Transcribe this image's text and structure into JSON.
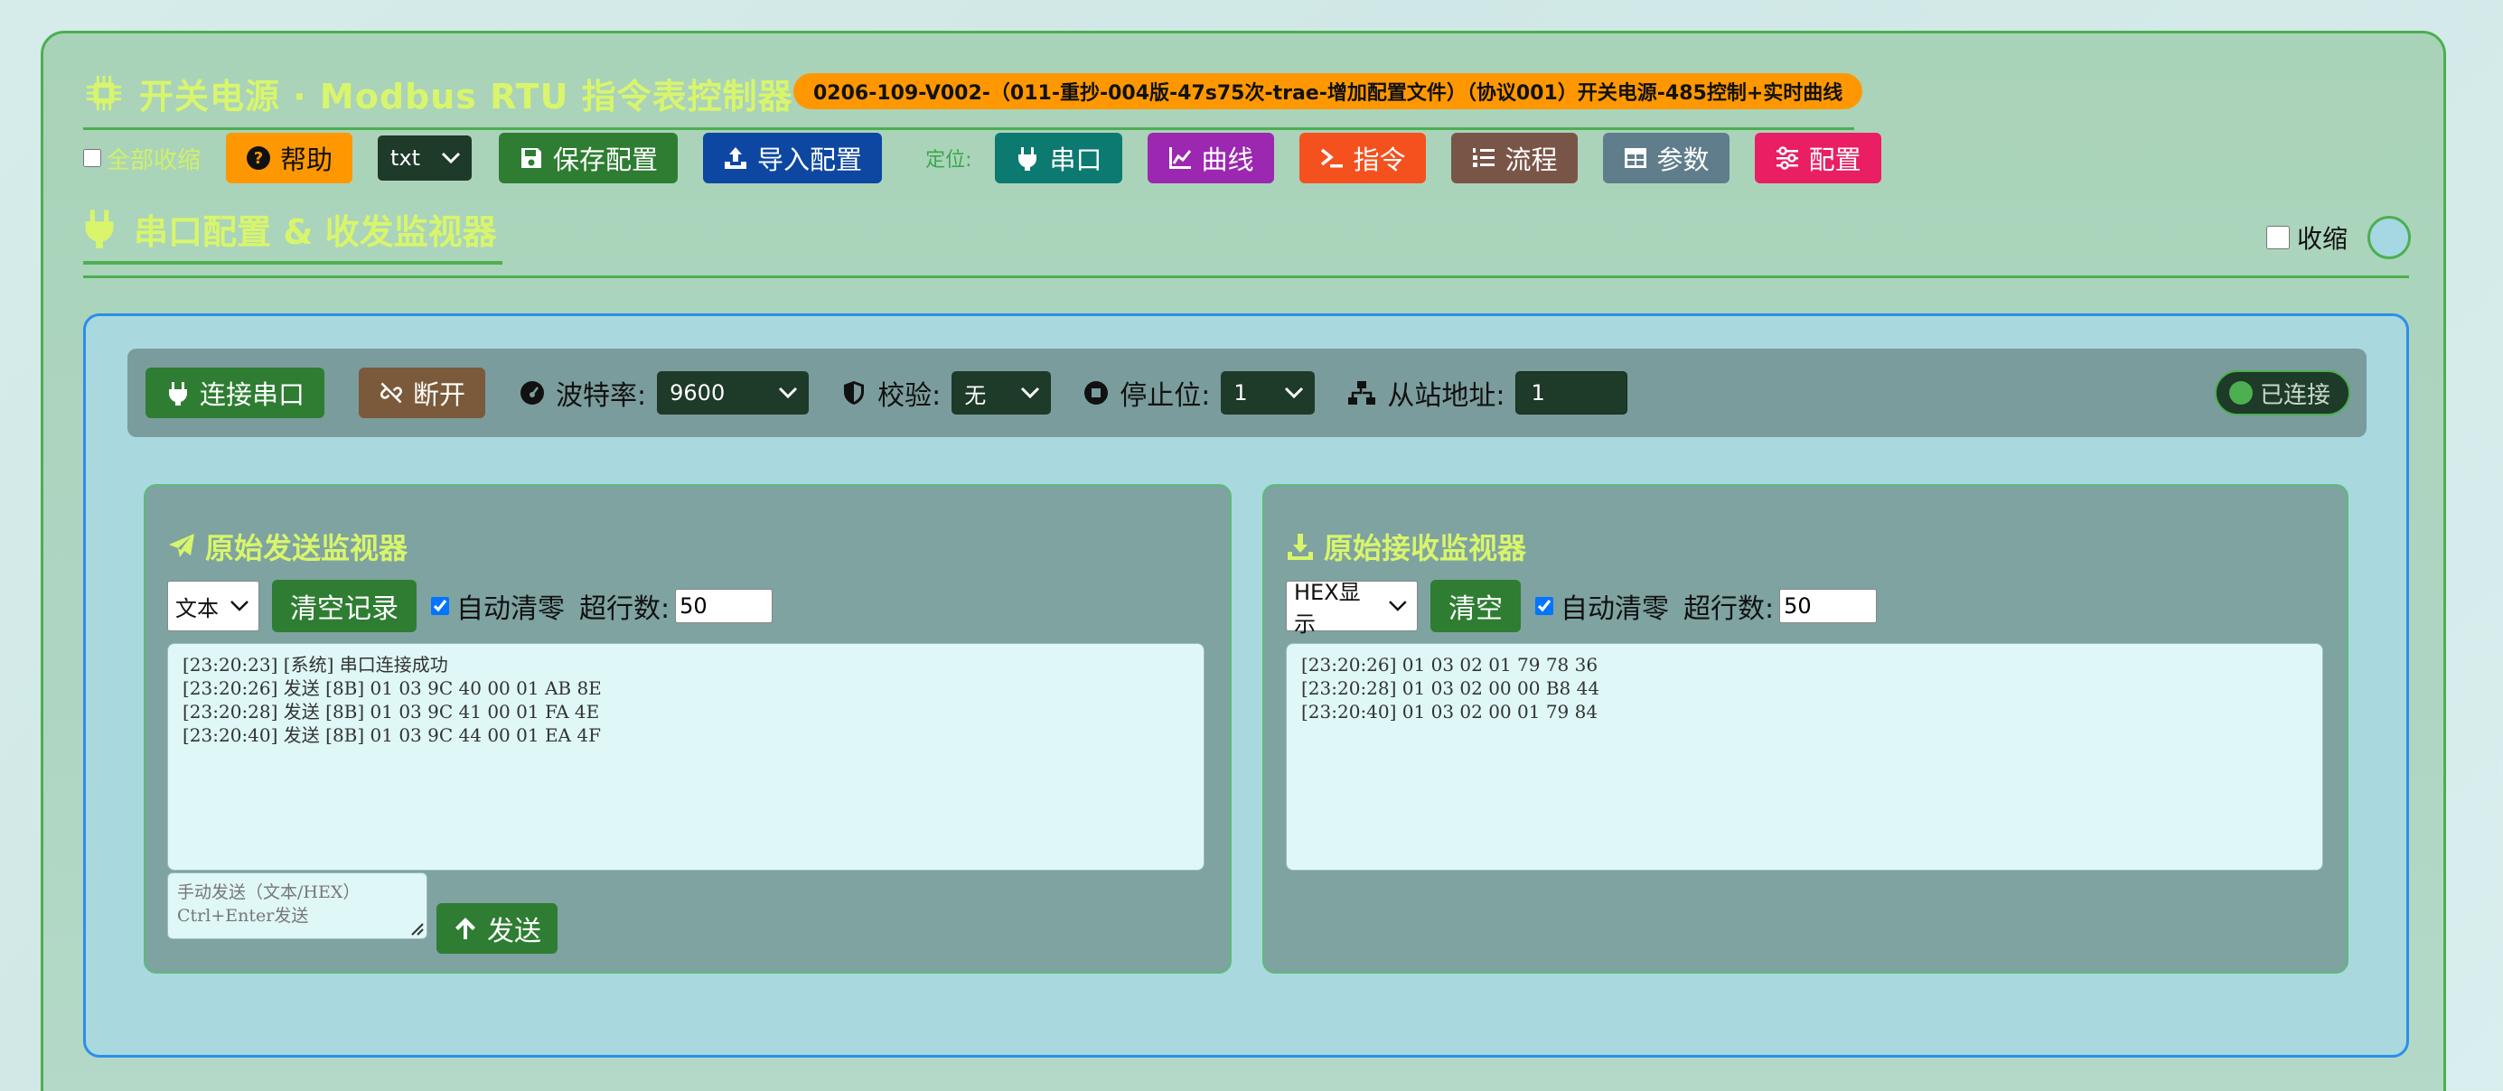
{
  "header": {
    "title": "开关电源 · Modbus RTU 指令表控制器",
    "version_badge": "0206-109-V002-（011-重抄-004版-47s75次-trae-增加配置文件）（协议001）开关电源-485控制+实时曲线",
    "title_icon": "chip-icon"
  },
  "toolbar": {
    "collapse_all_label": "全部收缩",
    "help_label": "帮助",
    "format_selected": "txt",
    "save_label": "保存配置",
    "import_label": "导入配置",
    "locate_label": "定位:",
    "nav": [
      {
        "label": "串口",
        "icon": "plug-icon",
        "color": "#0c7a70"
      },
      {
        "label": "曲线",
        "icon": "chart-line-icon",
        "color": "#9c27b0"
      },
      {
        "label": "指令",
        "icon": "terminal-icon",
        "color": "#f4511e"
      },
      {
        "label": "流程",
        "icon": "list-ol-icon",
        "color": "#795548"
      },
      {
        "label": "参数",
        "icon": "table-icon",
        "color": "#607d8b"
      },
      {
        "label": "配置",
        "icon": "sliders-icon",
        "color": "#e91e63"
      }
    ]
  },
  "section": {
    "title": "串口配置 & 收发监视器",
    "collapse_label": "收缩"
  },
  "connection": {
    "connect_label": "连接串口",
    "disconnect_label": "断开",
    "baud_label": "波特率:",
    "baud_value": "9600",
    "parity_label": "校验:",
    "parity_value": "无",
    "stopbits_label": "停止位:",
    "stopbits_value": "1",
    "slave_label": "从站地址:",
    "slave_value": "1",
    "status_label": "已连接"
  },
  "send_monitor": {
    "title": "原始发送监视器",
    "mode_selected": "文本",
    "clear_label": "清空记录",
    "auto_clear_label": "自动清零",
    "max_rows_label": "超行数:",
    "max_rows_value": "50",
    "log": [
      "[23:20:23] [系统] 串口连接成功",
      "[23:20:26] 发送 [8B] 01 03 9C 40 00 01 AB 8E",
      "[23:20:28] 发送 [8B] 01 03 9C 41 00 01 FA 4E",
      "[23:20:40] 发送 [8B] 01 03 9C 44 00 01 EA 4F"
    ],
    "manual_placeholder_line1": "手动发送（文本/HEX）",
    "manual_placeholder_line2": "Ctrl+Enter发送",
    "send_label": "发送"
  },
  "recv_monitor": {
    "title": "原始接收监视器",
    "mode_selected": "HEX显示",
    "clear_label": "清空",
    "auto_clear_label": "自动清零",
    "max_rows_label": "超行数:",
    "max_rows_value": "50",
    "log": [
      "[23:20:26] 01 03 02 01 79 78 36",
      "[23:20:28] 01 03 02 00 00 B8 44",
      "[23:20:40] 01 03 02 00 01 79 84"
    ]
  },
  "colors": {
    "accent_text": "#d8f56c",
    "green_button": "#2e7d32",
    "blue_button": "#0d47a1",
    "orange_badge": "#ff9800",
    "brown_button": "#7a5a3a"
  }
}
